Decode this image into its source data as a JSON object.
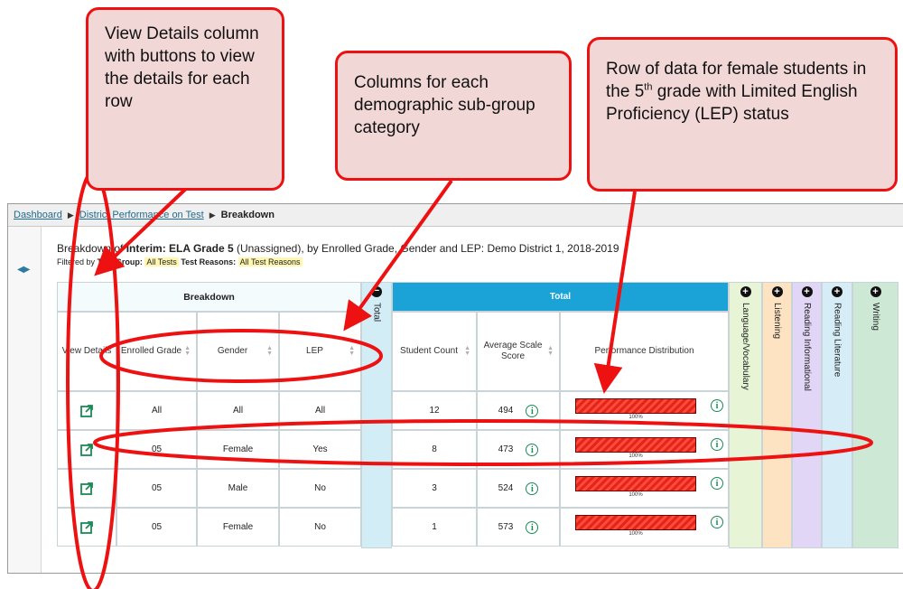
{
  "callouts": {
    "view_details": "View Details column with buttons to view the details for each row",
    "columns": "Columns for each demographic sub-group category",
    "row_pre": "Row of data for female students in the 5",
    "row_sup": "th",
    "row_post": " grade with Limited English Proficiency (LEP) status"
  },
  "breadcrumb": {
    "dashboard": "Dashboard",
    "district": "District Performance on Test",
    "current": "Breakdown"
  },
  "headline": {
    "prefix": "Breakdown of ",
    "test": "Interim: ELA Grade 5",
    "suffix": " (Unassigned), by Enrolled Grade, Gender and LEP: Demo District 1, 2018-2019"
  },
  "filters": {
    "label": "Filtered by",
    "group_label": "Test Group:",
    "group_value": "All Tests",
    "reasons_label": "Test Reasons:",
    "reasons_value": "All Test Reasons"
  },
  "table": {
    "breakdown_header": "Breakdown",
    "total_header": "Total",
    "total_vertical": "Total",
    "columns": {
      "view_details": "View Details",
      "enrolled_grade": "Enrolled Grade",
      "gender": "Gender",
      "lep": "LEP",
      "student_count": "Student Count",
      "avg_scale": "Average Scale Score",
      "perf_dist": "Performance Distribution"
    },
    "rows": [
      {
        "grade": "All",
        "gender": "All",
        "lep": "All",
        "count": "12",
        "score": "494",
        "dist": "100%"
      },
      {
        "grade": "05",
        "gender": "Female",
        "lep": "Yes",
        "count": "8",
        "score": "473",
        "dist": "100%"
      },
      {
        "grade": "05",
        "gender": "Male",
        "lep": "No",
        "count": "3",
        "score": "524",
        "dist": "100%"
      },
      {
        "grade": "05",
        "gender": "Female",
        "lep": "No",
        "count": "1",
        "score": "573",
        "dist": "100%"
      }
    ],
    "claims": [
      {
        "label": "Language/Vocabulary",
        "color": "#e7f4d6"
      },
      {
        "label": "Listening",
        "color": "#fde3c2"
      },
      {
        "label": "Reading Informational",
        "color": "#e1d6f6"
      },
      {
        "label": "Reading Literature",
        "color": "#d6edf7"
      },
      {
        "label": "Writing",
        "color": "#cde9d6"
      }
    ]
  },
  "colors": {
    "accent": "#1ba3d8",
    "annotation": "#ee1111",
    "bar": "#e3261a"
  }
}
